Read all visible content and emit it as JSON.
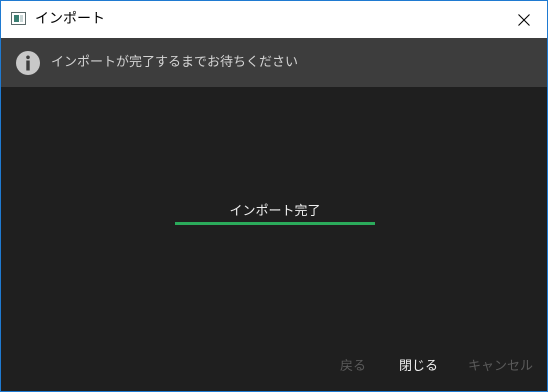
{
  "window": {
    "title": "インポート",
    "app_icon": "window-app-icon",
    "close_icon": "close-icon"
  },
  "info_bar": {
    "icon": "info-icon",
    "message": "インポートが完了するまでお待ちください"
  },
  "progress": {
    "label": "インポート完了",
    "fraction": 1.0,
    "color": "#2bab5b"
  },
  "footer": {
    "back_label": "戻る",
    "close_label": "閉じる",
    "cancel_label": "キャンセル",
    "back_enabled": false,
    "close_enabled": true,
    "cancel_enabled": false
  },
  "colors": {
    "window_border": "#1f7ad1",
    "background": "#1f1f1f",
    "info_bar": "#3d3d3d"
  }
}
